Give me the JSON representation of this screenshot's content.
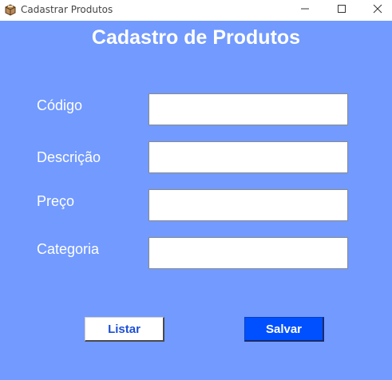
{
  "window": {
    "title": "Cadastrar Produtos",
    "app_icon": "package-icon",
    "controls": {
      "minimize_icon": "minimize-icon",
      "maximize_icon": "maximize-icon",
      "close_icon": "close-icon"
    }
  },
  "form": {
    "heading": "Cadastro de Produtos",
    "fields": [
      {
        "label": "Código",
        "value": "",
        "placeholder": ""
      },
      {
        "label": "Descrição",
        "value": "",
        "placeholder": ""
      },
      {
        "label": "Preço",
        "value": "",
        "placeholder": ""
      },
      {
        "label": "Categoria",
        "value": "",
        "placeholder": ""
      }
    ]
  },
  "actions": {
    "list_label": "Listar",
    "save_label": "Salvar"
  },
  "colors": {
    "background": "#729aff",
    "save_button": "#0050ff",
    "list_text": "#1e50d7"
  }
}
